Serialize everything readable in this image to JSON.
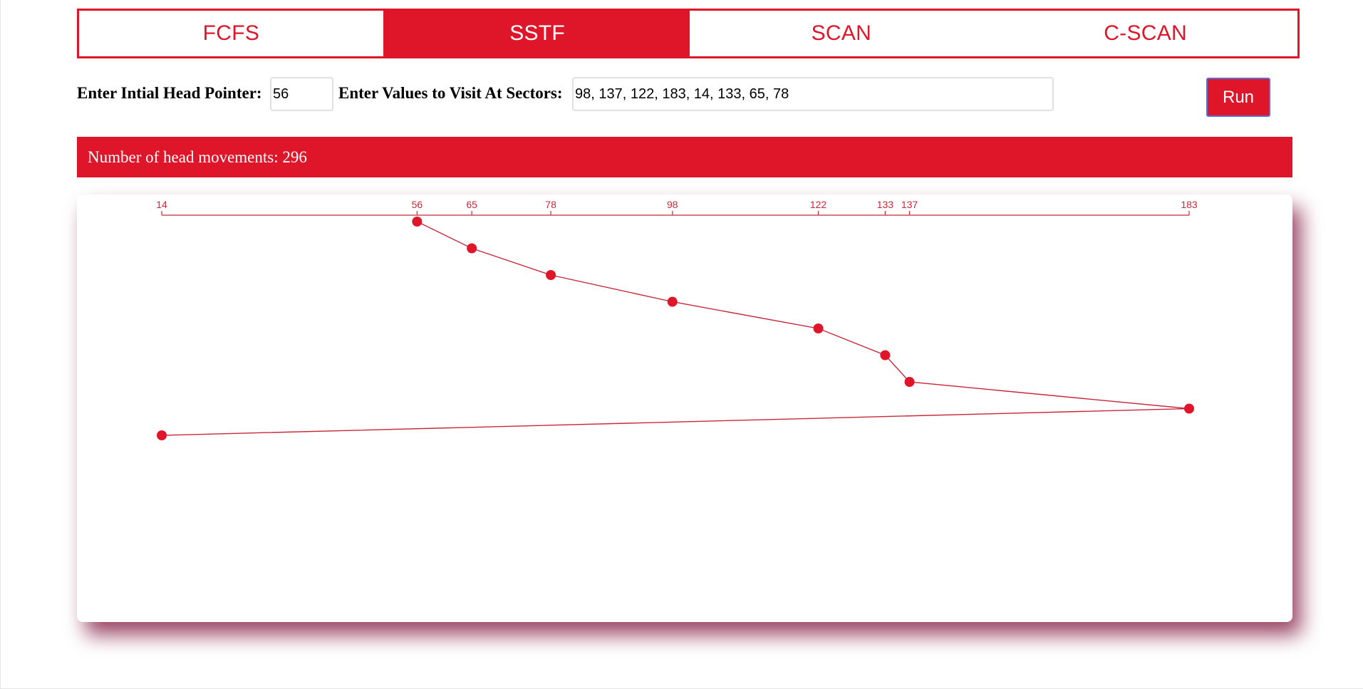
{
  "tabs": [
    {
      "label": "FCFS",
      "active": false
    },
    {
      "label": "SSTF",
      "active": true
    },
    {
      "label": "SCAN",
      "active": false
    },
    {
      "label": "C-SCAN",
      "active": false
    }
  ],
  "controls": {
    "head_label": "Enter Intial Head Pointer:",
    "head_value": "56",
    "sectors_label": "Enter Values to Visit At Sectors:",
    "sectors_value": "98, 137, 122, 183, 14, 133, 65, 78",
    "run_label": "Run"
  },
  "result": {
    "text": "Number of head movements: 296"
  },
  "colors": {
    "accent": "#df1529",
    "line": "#c8283a",
    "shadow": "#7a0a32"
  },
  "chart_data": {
    "type": "line",
    "x_ticks": [
      14,
      56,
      65,
      78,
      98,
      122,
      133,
      137,
      183
    ],
    "xlim": [
      14,
      183
    ],
    "visit_order": [
      56,
      65,
      78,
      98,
      122,
      133,
      137,
      183,
      14
    ],
    "axis_position": "top",
    "grid": false
  }
}
